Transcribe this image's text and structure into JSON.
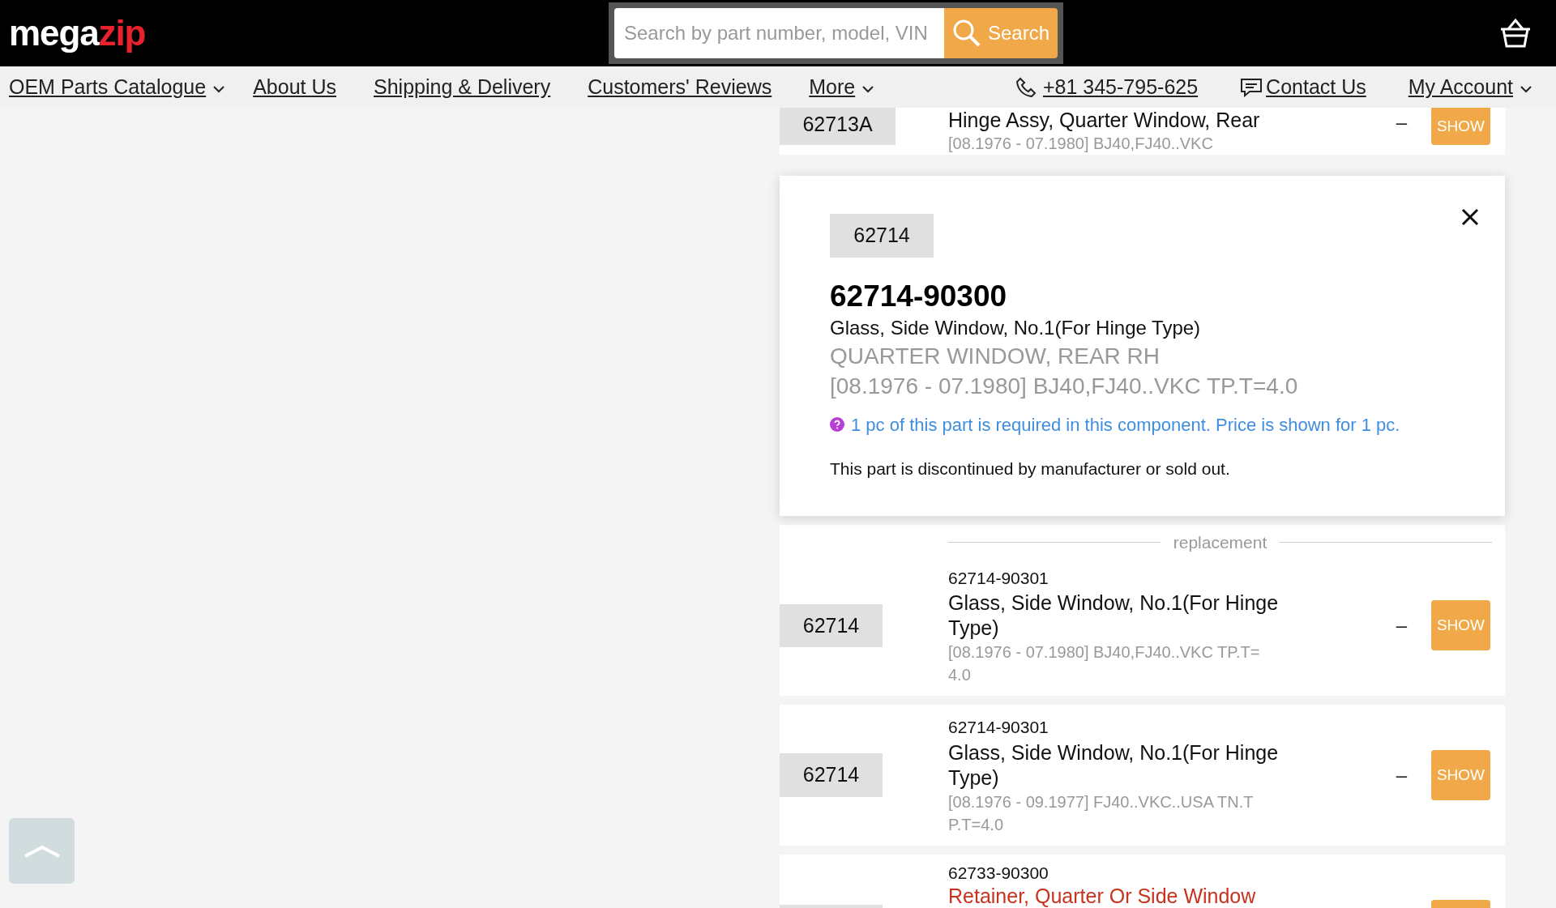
{
  "header": {
    "logo": {
      "part1": "mega",
      "part2": "zip"
    },
    "search": {
      "placeholder": "Search by part number, model, VIN",
      "button": "Search"
    }
  },
  "nav": {
    "items": [
      {
        "label": "OEM Parts Catalogue",
        "dropdown": true
      },
      {
        "label": "About Us",
        "dropdown": false
      },
      {
        "label": "Shipping & Delivery",
        "dropdown": false
      },
      {
        "label": "Customers' Reviews",
        "dropdown": false
      },
      {
        "label": "More",
        "dropdown": true
      }
    ],
    "phone": "+81 345-795-625",
    "contact": "Contact Us",
    "account": {
      "label": "My Account",
      "dropdown": true
    }
  },
  "rows_before": [
    {
      "chip": "62713A",
      "title": "Hinge Assy, Quarter Window, Rear",
      "fitment": "[08.1976 - 07.1980] BJ40,FJ40..VKC",
      "price": "–",
      "button": "SHOW"
    }
  ],
  "popup": {
    "chip": "62714",
    "part_number": "62714-90300",
    "title": "Glass, Side Window, No.1(For Hinge Type)",
    "subtitle": "QUARTER WINDOW, REAR RH",
    "fitment": "[08.1976 - 07.1980] BJ40,FJ40..VKC TP.T=4.0",
    "note": "1 pc of this part is required in this component. Price is shown for 1 pc.",
    "status": "This part is discontinued by manufacturer or sold out."
  },
  "replacement_label": "replacement",
  "rows_after": [
    {
      "chip": "62714",
      "part_number": "62714-90301",
      "title": "Glass, Side Window, No.1(For Hinge Type)",
      "color": "#111111",
      "fitment": "[08.1976 - 07.1980] BJ40,FJ40..VKC TP.T=4.0",
      "price": "–",
      "button": "SHOW"
    },
    {
      "chip": "62714",
      "part_number": "62714-90301",
      "title": "Glass, Side Window, No.1(For Hinge Type)",
      "color": "#111111",
      "fitment": "[08.1976 - 09.1977] FJ40..VKC..USA TN.TP.T=4.0",
      "price": "–",
      "button": "SHOW"
    },
    {
      "kind": "partial",
      "part_number": "62733-90300",
      "title": "Retainer, Quarter Or Side Window",
      "color": "#c8321e"
    }
  ]
}
